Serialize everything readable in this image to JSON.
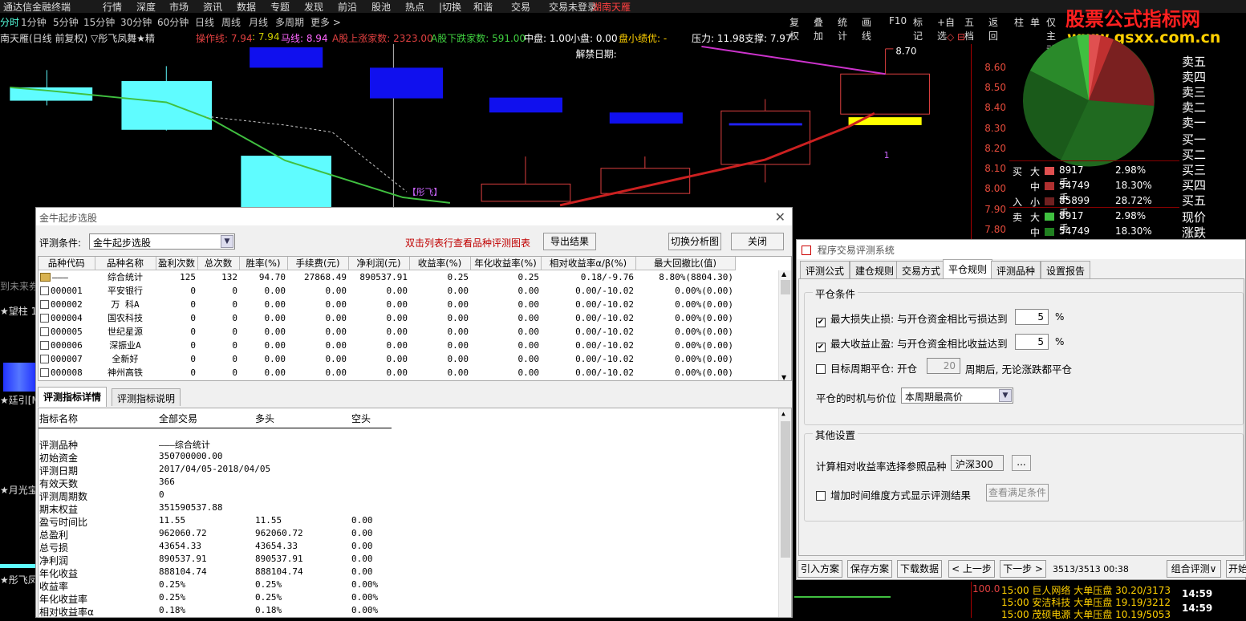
{
  "menubar": {
    "items": [
      "通达信金融终端",
      "行情",
      "深度",
      "市场",
      "资讯",
      "数据",
      "专题",
      "发现",
      "前沿",
      "股池",
      "热点",
      "|切换",
      "和谐",
      "交易",
      "交易未登录",
      "湖南天雁"
    ]
  },
  "periodbar": {
    "items": [
      "分时",
      "1分钟",
      "5分钟",
      "15分钟",
      "30分钟",
      "60分钟",
      "日线",
      "周线",
      "月线",
      "多周期",
      "更多 >"
    ]
  },
  "toolbar": {
    "items": [
      "复权",
      "叠加",
      "统计",
      "画线",
      "F10",
      "标记",
      "+自选",
      "五档",
      "返回",
      "柱",
      "单",
      "仅主动"
    ]
  },
  "logo": {
    "line1": "股票公式指标网",
    "line2": "www.gsxx.com.cn"
  },
  "infoline": {
    "title": "南天雁(日线 前复权) ▽彤飞凤舞★精",
    "items": [
      {
        "text": "操作线: 7.94",
        "color": "#e04040"
      },
      {
        "text": ": 7.94",
        "color": "#cccc00"
      },
      {
        "text": "马线: 8.94",
        "color": "#ff66ff"
      },
      {
        "text": "A股上涨家数: 2323.00",
        "color": "#e04040"
      },
      {
        "text": "A股下跌家数: 591.00",
        "color": "#40d040"
      },
      {
        "text": "中盘: 1.00",
        "color": "#ffffff"
      },
      {
        "text": "小盘: 0.00",
        "color": "#ffffff"
      },
      {
        "text": "盘小绩优: -",
        "color": "#ffd000"
      },
      {
        "text": "压力: 11.98",
        "color": "#ffffff"
      },
      {
        "text": "支撑: 7.97",
        "color": "#ffffff"
      }
    ]
  },
  "chart": {
    "unlock_label": "解禁日期:",
    "peak_label": "8.70",
    "marker_label": "【彤飞】",
    "one_label": "1"
  },
  "price_axis": [
    "8.60",
    "8.50",
    "8.40",
    "8.30",
    "8.20",
    "8.10",
    "8.00",
    "7.90",
    "7.80"
  ],
  "orderbook": [
    "卖五",
    "卖四",
    "卖三",
    "卖二",
    "卖一",
    "买一",
    "买二",
    "买三",
    "买四",
    "买五",
    "现价",
    "涨跌"
  ],
  "fundflow": [
    {
      "side": "买",
      "size": "大",
      "volume": "8917手",
      "pct": "2.98%",
      "color": "#e05050"
    },
    {
      "side": "",
      "size": "中",
      "volume": "54749手",
      "pct": "18.30%",
      "color": "#b03030"
    },
    {
      "side": "入",
      "size": "小",
      "volume": "85899手",
      "pct": "28.72%",
      "color": "#702020"
    },
    {
      "side": "卖",
      "size": "大",
      "volume": "8917手",
      "pct": "2.98%",
      "color": "#40c040"
    },
    {
      "side": "",
      "size": "中",
      "volume": "54749手",
      "pct": "18.30%",
      "color": "#208020"
    }
  ],
  "left_labels": [
    "到未来券",
    "★望柱 1",
    "★廷引[M",
    "★月光宝",
    "★彤飞凤"
  ],
  "dialog1": {
    "title": "金牛起步选股",
    "cond_label": "评测条件:",
    "cond_value": "金牛起步选股",
    "hint": "双击列表行查看品种评测图表",
    "export_btn": "导出结果",
    "switch_btn": "切换分析图",
    "close_btn": "关闭",
    "columns": [
      "品种代码",
      "品种名称",
      "盈利次数",
      "总次数",
      "胜率(%)",
      "手续费(元)",
      "净利润(元)",
      "收益率(%)",
      "年化收益率(%)",
      "相对收益率α/β(%)",
      "最大回撤比(值)"
    ],
    "rows": [
      [
        "———",
        "综合统计",
        "125",
        "132",
        "94.70",
        "27868.49",
        "890537.91",
        "0.25",
        "0.25",
        "0.18/-9.76",
        "8.80%(8804.30)"
      ],
      [
        "000001",
        "平安银行",
        "0",
        "0",
        "0.00",
        "0.00",
        "0.00",
        "0.00",
        "0.00",
        "0.00/-10.02",
        "0.00%(0.00)"
      ],
      [
        "000002",
        "万 科A",
        "0",
        "0",
        "0.00",
        "0.00",
        "0.00",
        "0.00",
        "0.00",
        "0.00/-10.02",
        "0.00%(0.00)"
      ],
      [
        "000004",
        "国农科技",
        "0",
        "0",
        "0.00",
        "0.00",
        "0.00",
        "0.00",
        "0.00",
        "0.00/-10.02",
        "0.00%(0.00)"
      ],
      [
        "000005",
        "世纪星源",
        "0",
        "0",
        "0.00",
        "0.00",
        "0.00",
        "0.00",
        "0.00",
        "0.00/-10.02",
        "0.00%(0.00)"
      ],
      [
        "000006",
        "深振业A",
        "0",
        "0",
        "0.00",
        "0.00",
        "0.00",
        "0.00",
        "0.00",
        "0.00/-10.02",
        "0.00%(0.00)"
      ],
      [
        "000007",
        "全新好",
        "0",
        "0",
        "0.00",
        "0.00",
        "0.00",
        "0.00",
        "0.00",
        "0.00/-10.02",
        "0.00%(0.00)"
      ],
      [
        "000008",
        "神州高铁",
        "0",
        "0",
        "0.00",
        "0.00",
        "0.00",
        "0.00",
        "0.00",
        "0.00/-10.02",
        "0.00%(0.00)"
      ]
    ],
    "tabs": [
      "评测指标详情",
      "评测指标说明"
    ],
    "detail_headers": [
      "指标名称",
      "全部交易",
      "多头",
      "空头"
    ],
    "detail_rows": [
      [
        "评测品种",
        "———综合统计",
        "",
        ""
      ],
      [
        "初始资金",
        "350700000.00",
        "",
        ""
      ],
      [
        "评测日期",
        "2017/04/05-2018/04/05",
        "",
        ""
      ],
      [
        "有效天数",
        "366",
        "",
        ""
      ],
      [
        "评测周期数",
        "0",
        "",
        ""
      ],
      [
        "期末权益",
        "351590537.88",
        "",
        ""
      ],
      [
        "盈亏时间比",
        "11.55",
        "11.55",
        "0.00"
      ],
      [
        "总盈利",
        "962060.72",
        "962060.72",
        "0.00"
      ],
      [
        "总亏损",
        "43654.33",
        "43654.33",
        "0.00"
      ],
      [
        "净利润",
        "890537.91",
        "890537.91",
        "0.00"
      ],
      [
        "年化收益",
        "888104.74",
        "888104.74",
        "0.00"
      ],
      [
        "收益率",
        "0.25%",
        "0.25%",
        "0.00%"
      ],
      [
        "年化收益率",
        "0.25%",
        "0.25%",
        "0.00%"
      ],
      [
        "相对收益率α",
        "0.18%",
        "0.18%",
        "0.00%"
      ]
    ]
  },
  "dialog2": {
    "title": "程序交易评测系统",
    "tabs": [
      "评测公式",
      "建仓规则",
      "交易方式",
      "平仓规则",
      "评测品种",
      "设置报告"
    ],
    "group1": "平仓条件",
    "stoploss_label": "最大损失止损: 与开仓资金相比亏损达到",
    "stoploss_value": "5",
    "takeprofit_label": "最大收益止盈: 与开仓资金相比收益达到",
    "takeprofit_value": "5",
    "pct": "%",
    "target_label": "目标周期平仓: 开仓",
    "target_value": "20",
    "target_suffix": "周期后, 无论涨跌都平仓",
    "timing_label": "平仓的时机与价位",
    "timing_value": "本周期最高价",
    "group2": "其他设置",
    "ref_label": "计算相对收益率选择参照品种",
    "ref_value": "沪深300",
    "ref_btn": "...",
    "timedim_label": "增加时间维度方式显示评测结果",
    "view_btn": "查看满足条件"
  },
  "bottombar": {
    "buttons": [
      "引入方案",
      "保存方案",
      "下载数据",
      "< 上一步",
      "下一步 >",
      "组合评测∨",
      "开始"
    ],
    "status": "3513/3513 00:38"
  },
  "ticker": {
    "value": "100.0",
    "rows": [
      {
        "time": "15:00",
        "name": "巨人网络",
        "desc": "大单压盘",
        "val": "30.20/3173",
        "clock": "14:59"
      },
      {
        "time": "15:00",
        "name": "安洁科技",
        "desc": "大单压盘",
        "val": "19.19/3212",
        "clock": "14:59"
      },
      {
        "time": "15:00",
        "name": "茂硕电源",
        "desc": "大单压盘",
        "val": "10.19/5053",
        "clock": ""
      }
    ]
  },
  "colors": {
    "up": "#e04040",
    "down": "#40d040",
    "cyan": "#5ffcff",
    "blue": "#1010ee"
  }
}
